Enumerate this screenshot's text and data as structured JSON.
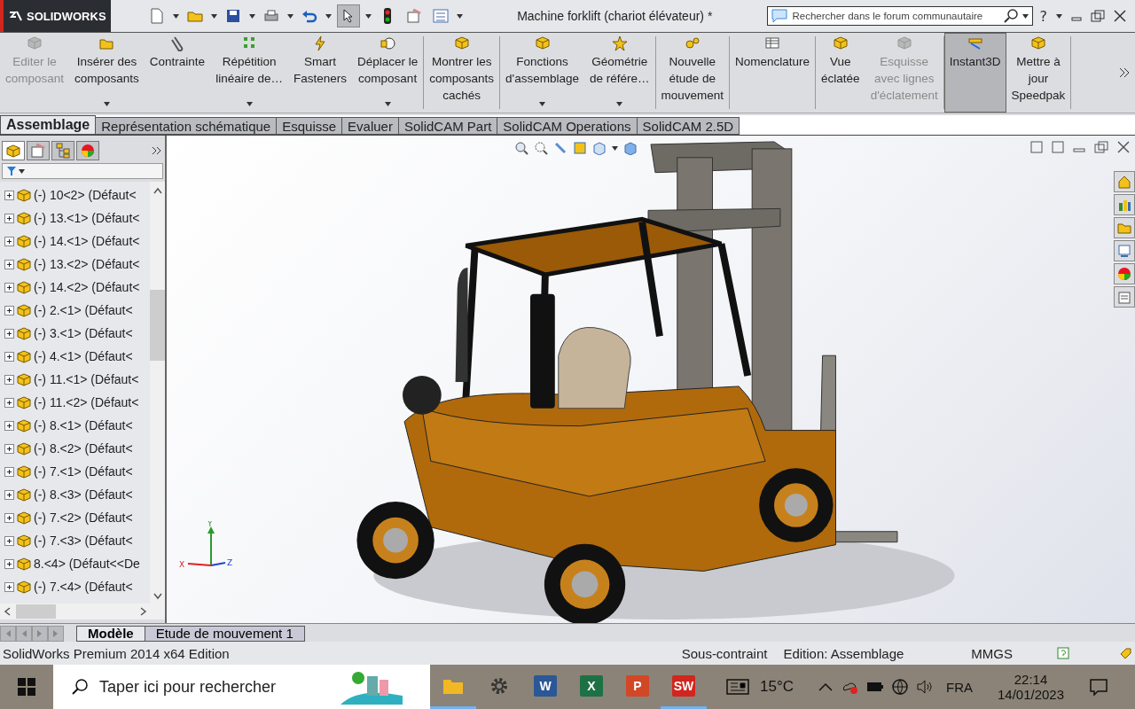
{
  "app": {
    "name": "SOLIDWORKS"
  },
  "window": {
    "title": "Machine forklift (chariot élévateur) *"
  },
  "search": {
    "placeholder": "Rechercher dans le forum communautaire"
  },
  "help": {
    "label": "?"
  },
  "ribbon": {
    "groups": [
      {
        "buttons": [
          {
            "label": "Editer le\ncomposant",
            "disabled": true,
            "menu": false,
            "selected": false
          },
          {
            "label": "Insérer des\ncomposants",
            "disabled": false,
            "menu": true,
            "selected": false
          },
          {
            "label": "Contrainte",
            "disabled": false,
            "menu": false,
            "selected": false
          },
          {
            "label": "Répétition\nlinéaire de…",
            "disabled": false,
            "menu": true,
            "selected": false
          },
          {
            "label": "Smart\nFasteners",
            "disabled": false,
            "menu": false,
            "selected": false
          },
          {
            "label": "Déplacer le\ncomposant",
            "disabled": false,
            "menu": true,
            "selected": false
          }
        ]
      },
      {
        "buttons": [
          {
            "label": "Montrer les\ncomposants\ncachés",
            "disabled": false,
            "menu": false,
            "selected": false
          }
        ]
      },
      {
        "buttons": [
          {
            "label": "Fonctions\nd'assemblage",
            "disabled": false,
            "menu": true,
            "selected": false
          },
          {
            "label": "Géométrie\nde référe…",
            "disabled": false,
            "menu": true,
            "selected": false
          }
        ]
      },
      {
        "buttons": [
          {
            "label": "Nouvelle\nétude de\nmouvement",
            "disabled": false,
            "menu": false,
            "selected": false
          }
        ]
      },
      {
        "buttons": [
          {
            "label": "Nomenclature",
            "disabled": false,
            "menu": false,
            "selected": false
          }
        ]
      },
      {
        "buttons": [
          {
            "label": "Vue\néclatée",
            "disabled": false,
            "menu": false,
            "selected": false
          },
          {
            "label": "Esquisse\navec lignes\nd'éclatement",
            "disabled": true,
            "menu": false,
            "selected": false
          }
        ]
      },
      {
        "buttons": [
          {
            "label": "Instant3D",
            "disabled": false,
            "menu": false,
            "selected": true
          },
          {
            "label": "Mettre à\njour\nSpeedpak",
            "disabled": false,
            "menu": false,
            "selected": false
          }
        ]
      }
    ]
  },
  "tabs": [
    {
      "label": "Assemblage",
      "selected": true
    },
    {
      "label": "Représentation schématique",
      "selected": false
    },
    {
      "label": "Esquisse",
      "selected": false
    },
    {
      "label": "Evaluer",
      "selected": false
    },
    {
      "label": "SolidCAM Part",
      "selected": false
    },
    {
      "label": "SolidCAM Operations",
      "selected": false
    },
    {
      "label": "SolidCAM 2.5D",
      "selected": false
    }
  ],
  "panel_tabs": [
    {
      "selected": true
    },
    {
      "selected": false
    },
    {
      "selected": false
    },
    {
      "selected": false
    }
  ],
  "tree": {
    "items": [
      {
        "label": "(-) 10<2> (Défaut<"
      },
      {
        "label": "(-) 13.<1> (Défaut<"
      },
      {
        "label": "(-) 14.<1> (Défaut<"
      },
      {
        "label": "(-) 13.<2> (Défaut<"
      },
      {
        "label": "(-) 14.<2> (Défaut<"
      },
      {
        "label": "(-) 2.<1> (Défaut<"
      },
      {
        "label": "(-) 3.<1> (Défaut<"
      },
      {
        "label": "(-) 4.<1> (Défaut<"
      },
      {
        "label": "(-) 11.<1> (Défaut<"
      },
      {
        "label": "(-) 11.<2> (Défaut<"
      },
      {
        "label": "(-) 8.<1> (Défaut<"
      },
      {
        "label": "(-) 8.<2> (Défaut<"
      },
      {
        "label": "(-) 7.<1> (Défaut<"
      },
      {
        "label": "(-) 8.<3> (Défaut<"
      },
      {
        "label": "(-) 7.<2> (Défaut<"
      },
      {
        "label": "(-) 7.<3> (Défaut<"
      },
      {
        "label": "8.<4> (Défaut<<De"
      },
      {
        "label": "(-) 7.<4> (Défaut<"
      }
    ]
  },
  "triad": {
    "x": "X",
    "y": "Y",
    "z": "Z"
  },
  "bottom_tabs": [
    {
      "label": "Modèle",
      "selected": true
    },
    {
      "label": "Etude de mouvement 1",
      "selected": false
    }
  ],
  "status_bar": {
    "edition": "SolidWorks Premium 2014 x64 Edition",
    "state": "Sous-contraint",
    "mode": "Edition: Assemblage",
    "units": "MMGS"
  },
  "taskbar": {
    "search_placeholder": "Taper ici pour rechercher",
    "apps": [
      {
        "kind": "folder",
        "open": true
      },
      {
        "kind": "gear",
        "open": false
      },
      {
        "kind": "word",
        "letter": "W",
        "open": false
      },
      {
        "kind": "excel",
        "letter": "X",
        "open": false
      },
      {
        "kind": "powerpoint",
        "letter": "P",
        "open": false
      },
      {
        "kind": "solidworks",
        "letter": "SW",
        "open": true
      }
    ],
    "temperature": "15°C",
    "language": "FRA",
    "time": "22:14",
    "date": "14/01/2023"
  }
}
